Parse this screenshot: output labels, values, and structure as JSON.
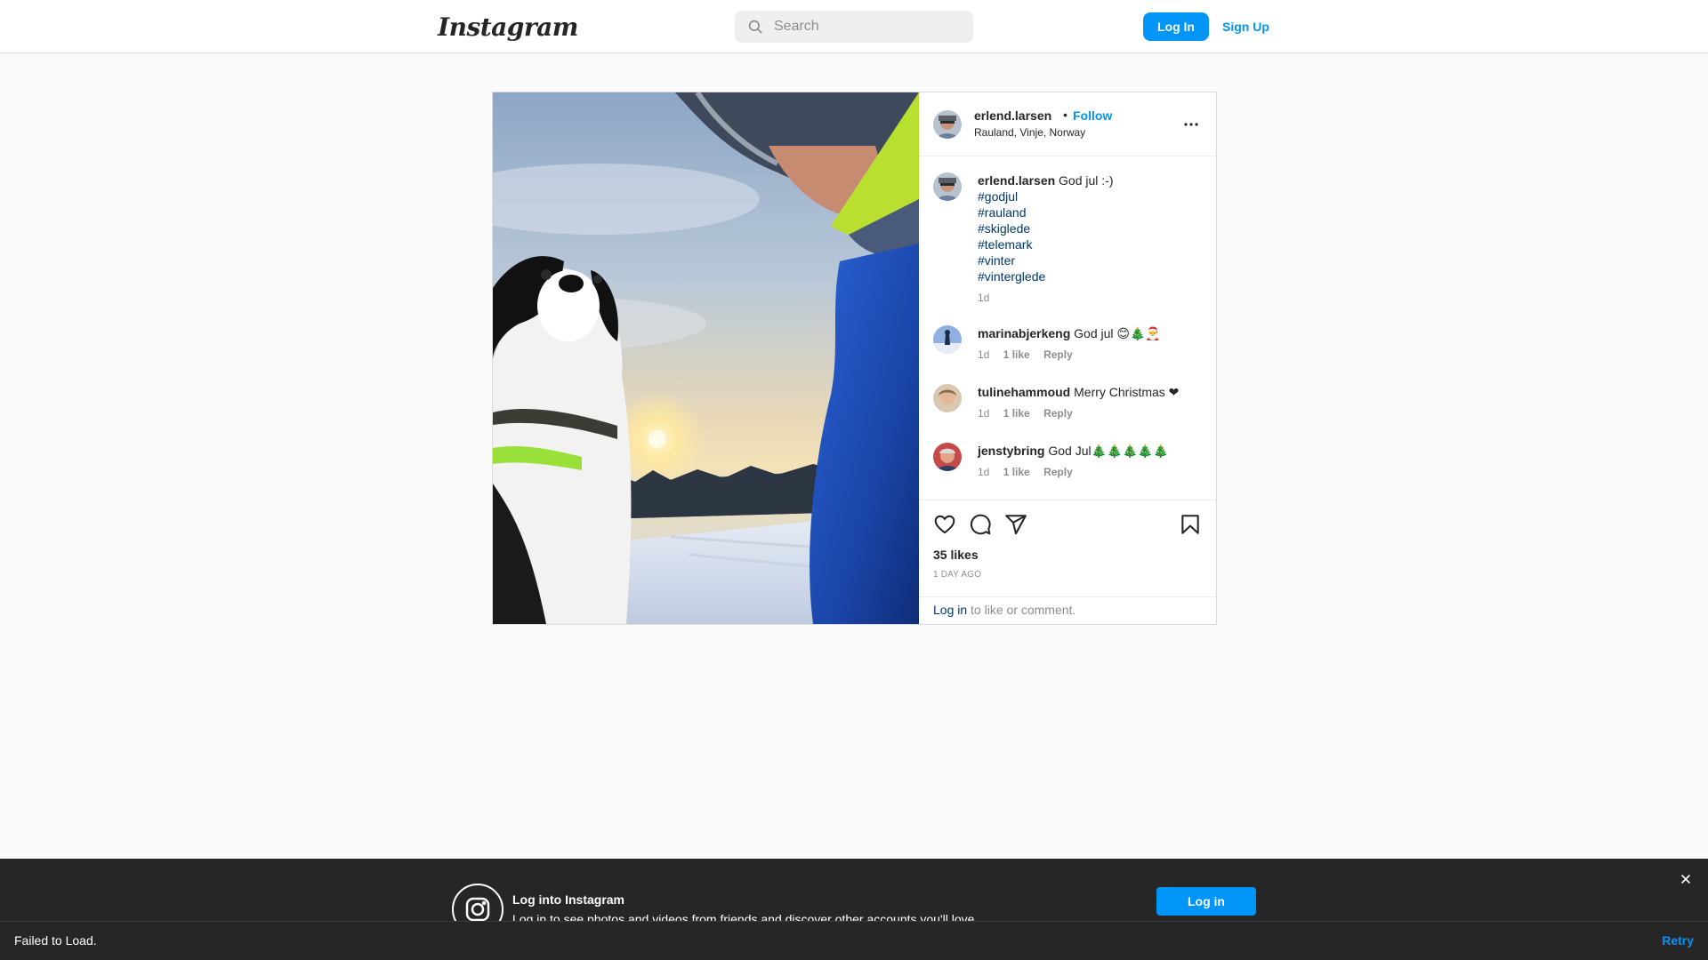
{
  "nav": {
    "logo": "Instagram",
    "search_placeholder": "Search",
    "login_label": "Log In",
    "signup_label": "Sign Up"
  },
  "post": {
    "author": "erlend.larsen",
    "separator": "•",
    "follow_label": "Follow",
    "location": "Rauland, Vinje, Norway",
    "caption": {
      "user": "erlend.larsen",
      "text": "God jul :-)",
      "hashtags": [
        "#godjul",
        "#rauland",
        "#skiglede",
        "#telemark",
        "#vinter",
        "#vinterglede"
      ],
      "time": "1d"
    },
    "comments": [
      {
        "user": "marinabjerkeng",
        "text": "God jul 😊🎄🎅",
        "time": "1d",
        "likes": "1 like",
        "reply": "Reply"
      },
      {
        "user": "tulinehammoud",
        "text": "Merry Christmas ❤",
        "time": "1d",
        "likes": "1 like",
        "reply": "Reply"
      },
      {
        "user": "jenstybring",
        "text": "God Jul🎄🎄🎄🎄🎄",
        "time": "1d",
        "likes": "1 like",
        "reply": "Reply"
      }
    ],
    "likes": "35 likes",
    "time_ago": "1 DAY AGO",
    "login_link": "Log in",
    "login_rest": " to like or comment."
  },
  "banner": {
    "title": "Log into Instagram",
    "subtitle": "Log in to see photos and videos from friends and discover other accounts you'll love.",
    "login_label": "Log in"
  },
  "toast": {
    "message": "Failed to Load.",
    "retry_label": "Retry"
  },
  "colors": {
    "accent": "#0095f6",
    "link": "#00376b",
    "muted": "#8e8e8e",
    "banner_bg": "#262626"
  },
  "icons": [
    "search-icon",
    "more-options-icon",
    "heart-icon",
    "comment-icon",
    "share-icon",
    "bookmark-icon",
    "instagram-glyph-icon",
    "close-icon"
  ]
}
